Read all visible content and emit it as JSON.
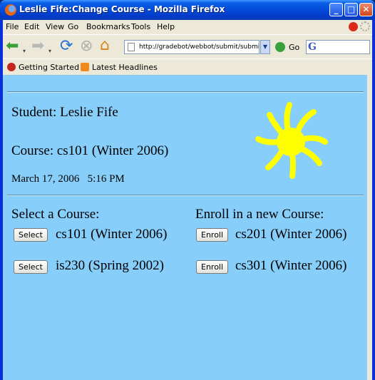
{
  "window": {
    "title": "Leslie Fife:Change Course - Mozilla Firefox"
  },
  "menu": [
    "File",
    "Edit",
    "View",
    "Go",
    "Bookmarks",
    "Tools",
    "Help"
  ],
  "address_bar": {
    "url": "http://gradebot/webbot/submit/submit.cg",
    "go_label": "Go"
  },
  "bookmarks": [
    "Getting Started",
    "Latest Headlines"
  ],
  "page": {
    "student_line": "Student: Leslie Fife",
    "course_line": "Course: cs101 (Winter 2006)",
    "datetime": "March 17, 2006   5:16 PM",
    "select_heading": "Select a Course:",
    "enroll_heading": "Enroll in a new Course:",
    "select_courses": [
      {
        "button": "Select",
        "course": "cs101 (Winter 2006)"
      },
      {
        "button": "Select",
        "course": "is230 (Spring 2002)"
      }
    ],
    "enroll_courses": [
      {
        "button": "Enroll",
        "course": "cs201 (Winter 2006)"
      },
      {
        "button": "Enroll",
        "course": "cs301 (Winter 2006)"
      }
    ]
  },
  "colors": {
    "page_bg": "#87cefa",
    "sun": "#ffff00",
    "titlebar": "#0348d6"
  }
}
